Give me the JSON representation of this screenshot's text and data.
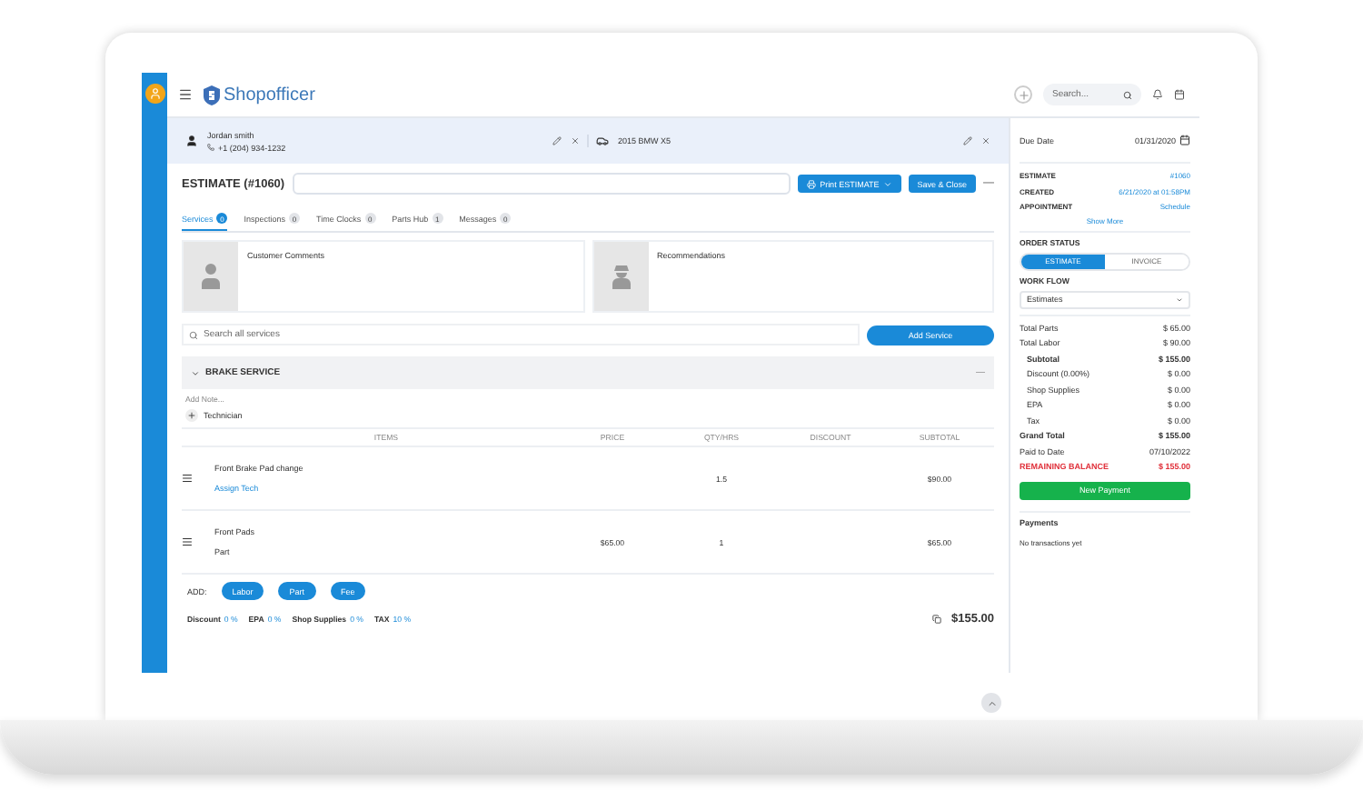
{
  "topbar": {
    "logo": "Shopofficer",
    "search": {
      "placeholder": "Search..."
    }
  },
  "customer": {
    "name": "Jordan smith",
    "phone": "+1 (204) 934-1232"
  },
  "vehicle": {
    "name": "2015 BMW X5"
  },
  "estimate": {
    "title": "ESTIMATE (#1060)",
    "print_button": "Print ESTIMATE",
    "save_button": "Save & Close",
    "more": "—"
  },
  "tabs": [
    {
      "label": "Services",
      "count": "0",
      "selected": true
    },
    {
      "label": "Inspections",
      "count": "0",
      "selected": false
    },
    {
      "label": "Time Clocks",
      "count": "0",
      "selected": false
    },
    {
      "label": "Parts Hub",
      "count": "1",
      "selected": false
    },
    {
      "label": "Messages",
      "count": "0",
      "selected": false
    }
  ],
  "cards": [
    {
      "title": "Customer Comments",
      "kind": "person"
    },
    {
      "title": "Recommendations",
      "kind": "mechanic"
    }
  ],
  "service_search": {
    "placeholder": "Search all services"
  },
  "add_service": "Add Service",
  "service": {
    "title": "BRAKE SERVICE",
    "collapse": "—",
    "add_note": "Add Note...",
    "technician": "Technician",
    "columns": [
      "ITEMS",
      "PRICE",
      "QTY/HRS",
      "DISCOUNT",
      "SUBTOTAL"
    ],
    "rows": [
      {
        "kind": "labor",
        "item": "Front Brake Pad change",
        "sub": "Assign Tech",
        "price": "",
        "qty": "1.5",
        "discount": "",
        "subtotal": "$90.00"
      },
      {
        "kind": "part",
        "item": "Front Pads",
        "sub": "Part",
        "price": "$65.00",
        "qty": "1",
        "discount": "",
        "subtotal": "$65.00"
      }
    ],
    "add_label": "ADD:",
    "add_buttons": [
      "Labor",
      "Part",
      "Fee"
    ],
    "fees": [
      {
        "label": "Discount",
        "value": "0 %"
      },
      {
        "label": "EPA",
        "value": "0 %"
      },
      {
        "label": "Shop Supplies",
        "value": "0 %"
      },
      {
        "label": "TAX",
        "value": "10 %"
      }
    ],
    "total": "$155.00"
  },
  "side": {
    "due_date": {
      "label": "Due Date",
      "value": "01/31/2020"
    },
    "info": [
      {
        "label": "ESTIMATE",
        "value": "#1060"
      },
      {
        "label": "CREATED",
        "value": "6/21/2020 at 01:58PM"
      },
      {
        "label": "APPOINTMENT",
        "value": "Schedule"
      }
    ],
    "show_more": "Show More",
    "order_status": {
      "label": "ORDER STATUS",
      "options": [
        {
          "label": "ESTIMATE",
          "selected": true
        },
        {
          "label": "INVOICE",
          "selected": false
        }
      ]
    },
    "work_flow": {
      "label": "WORK FLOW",
      "value": "Estimates"
    },
    "totals": [
      {
        "kind": "plain",
        "label": "Total Parts",
        "value": "$ 65.00"
      },
      {
        "kind": "plain",
        "label": "Total Labor",
        "value": "$ 90.00"
      },
      {
        "kind": "bold",
        "label": "Subtotal",
        "value": "$ 155.00"
      },
      {
        "kind": "indent",
        "label": "Discount (0.00%)",
        "value": "$ 0.00"
      },
      {
        "kind": "indent",
        "label": "Shop Supplies",
        "value": "$ 0.00"
      },
      {
        "kind": "indent",
        "label": "EPA",
        "value": "$ 0.00"
      },
      {
        "kind": "indent",
        "label": "Tax",
        "value": "$ 0.00"
      },
      {
        "kind": "bold",
        "label": "Grand Total",
        "value": "$ 155.00"
      },
      {
        "kind": "plain",
        "label": "Paid to Date",
        "value": "07/10/2022"
      },
      {
        "kind": "alert",
        "label": "REMAINING BALANCE",
        "value": "$ 155.00"
      }
    ],
    "payment_button": "New Payment",
    "payments": {
      "title": "Payments",
      "empty": "No transactions yet"
    }
  }
}
